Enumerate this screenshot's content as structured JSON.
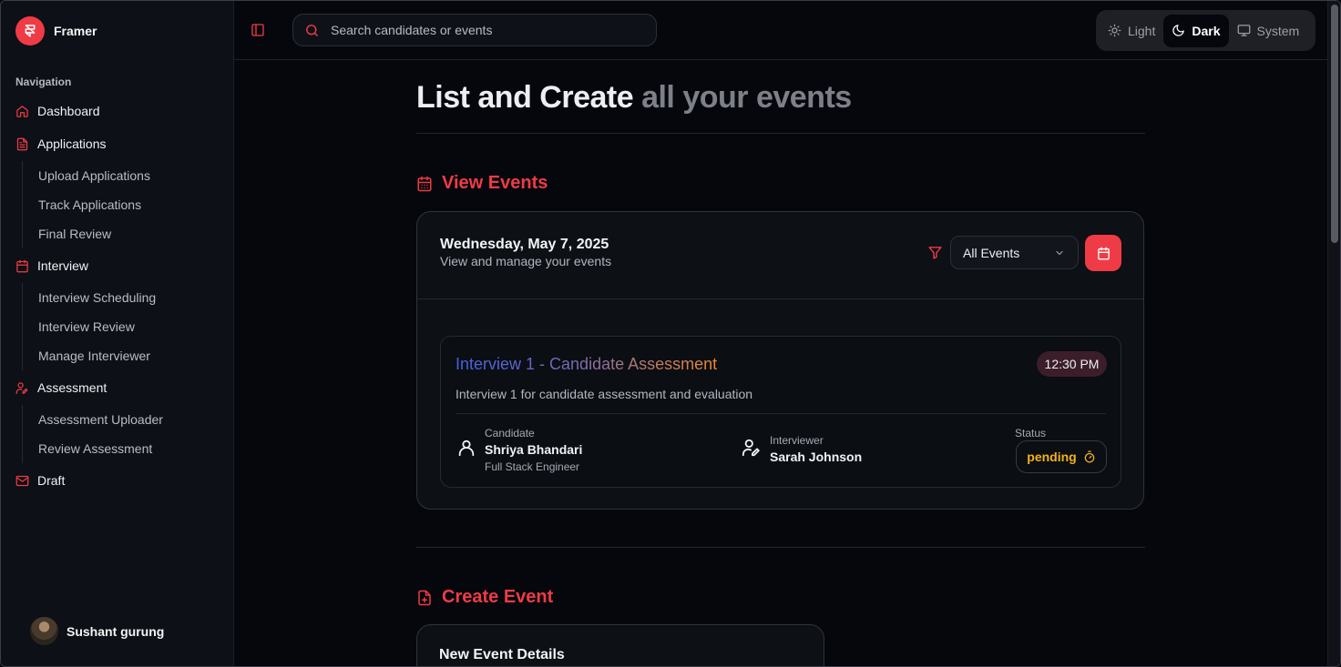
{
  "app": {
    "name": "Framer"
  },
  "sidebar": {
    "heading": "Navigation",
    "items": [
      {
        "label": "Dashboard",
        "icon": "home-icon"
      },
      {
        "label": "Applications",
        "icon": "file-text-icon",
        "children": [
          "Upload Applications",
          "Track Applications",
          "Final Review"
        ]
      },
      {
        "label": "Interview",
        "icon": "calendar-icon",
        "children": [
          "Interview Scheduling",
          "Interview Review",
          "Manage Interviewer"
        ]
      },
      {
        "label": "Assessment",
        "icon": "user-pen-icon",
        "children": [
          "Assessment Uploader",
          "Review Assessment"
        ]
      },
      {
        "label": "Draft",
        "icon": "mail-icon"
      }
    ],
    "user": {
      "name": "Sushant gurung"
    }
  },
  "topbar": {
    "search_placeholder": "Search candidates or events",
    "theme": {
      "options": [
        "Light",
        "Dark",
        "System"
      ],
      "selected": "Dark"
    }
  },
  "main": {
    "title_part1": "List and Create",
    "title_part2": " all your events",
    "view_events": {
      "heading": "View Events",
      "date": "Wednesday, May 7, 2025",
      "subtitle": "View and manage your events",
      "filter_value": "All Events",
      "event": {
        "title": "Interview 1 - Candidate Assessment",
        "time": "12:30 PM",
        "description": "Interview 1 for candidate assessment and evaluation",
        "candidate_label": "Candidate",
        "candidate_name": "Shriya Bhandari",
        "candidate_role": "Full Stack Engineer",
        "interviewer_label": "Interviewer",
        "interviewer_name": "Sarah Johnson",
        "status_label": "Status",
        "status": "pending"
      }
    },
    "create_event": {
      "heading": "Create Event",
      "card_title": "New Event Details"
    }
  },
  "colors": {
    "accent": "#ef3b45",
    "status_pending": "#f2b31b",
    "background": "#05070c"
  }
}
